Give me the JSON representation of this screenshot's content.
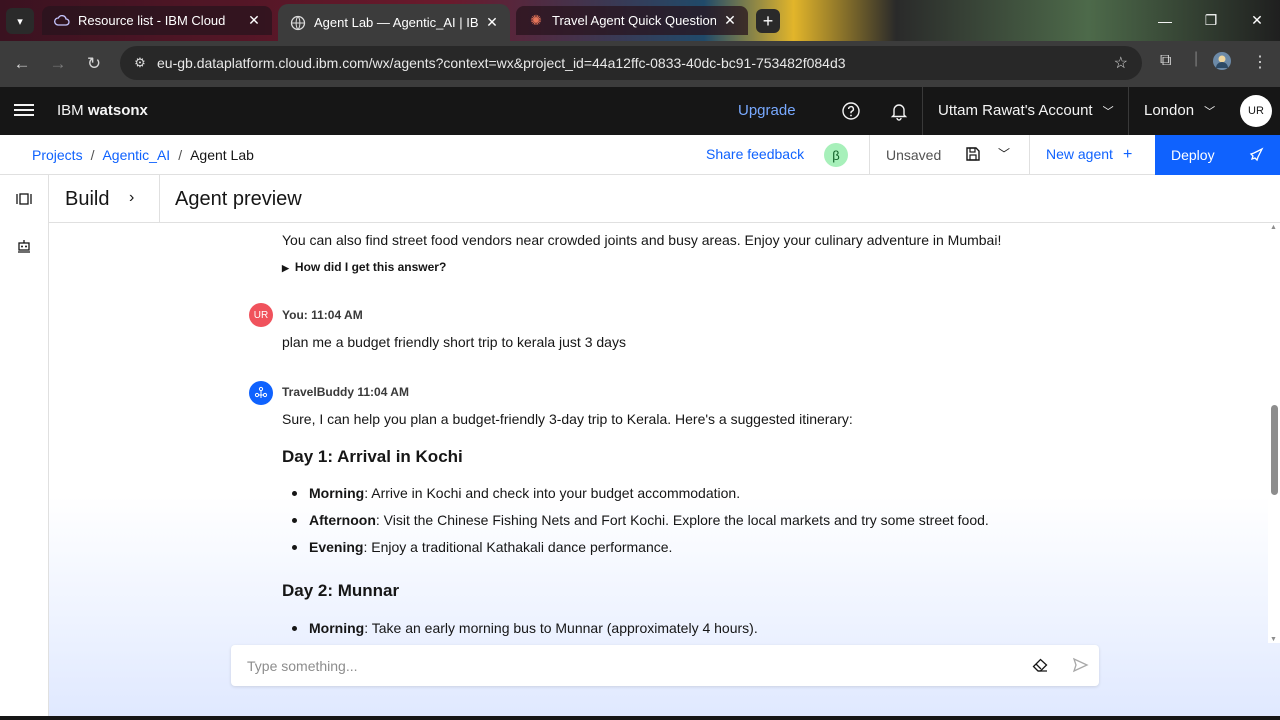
{
  "browser": {
    "tabs": [
      {
        "title": "Resource list - IBM Cloud",
        "active": false
      },
      {
        "title": "Agent Lab — Agentic_AI | IBM w",
        "active": true
      },
      {
        "title": "Travel Agent Quick Questions -",
        "active": false
      }
    ],
    "url": "eu-gb.dataplatform.cloud.ibm.com/wx/agents?context=wx&project_id=44a12ffc-0833-40dc-bc91-753482f084d3"
  },
  "header": {
    "brand_prefix": "IBM",
    "brand_name": "watsonx",
    "upgrade": "Upgrade",
    "account": "Uttam Rawat's Account",
    "region": "London",
    "avatar": "UR"
  },
  "toolbar": {
    "breadcrumbs": [
      "Projects",
      "Agentic_AI",
      "Agent Lab"
    ],
    "share_feedback": "Share feedback",
    "beta": "β",
    "status": "Unsaved",
    "new_agent": "New agent",
    "deploy": "Deploy"
  },
  "panel": {
    "build": "Build",
    "title": "Agent preview"
  },
  "chat": {
    "prev_text": "You can also find street food vendors near crowded joints and busy areas. Enjoy your culinary adventure in Mumbai!",
    "how": "How did I get this answer?",
    "user": {
      "avatar": "UR",
      "label": "You: 11:04 AM",
      "text": "plan me a budget friendly short trip to kerala just 3 days"
    },
    "bot": {
      "label": "TravelBuddy 11:04 AM",
      "intro": "Sure, I can help you plan a budget-friendly 3-day trip to Kerala. Here's a suggested itinerary:",
      "day1": {
        "heading": "Day 1: Arrival in Kochi",
        "items": [
          {
            "label": "Morning",
            "text": ": Arrive in Kochi and check into your budget accommodation."
          },
          {
            "label": "Afternoon",
            "text": ": Visit the Chinese Fishing Nets and Fort Kochi. Explore the local markets and try some street food."
          },
          {
            "label": "Evening",
            "text": ": Enjoy a traditional Kathakali dance performance."
          }
        ]
      },
      "day2": {
        "heading": "Day 2: Munnar",
        "items": [
          {
            "label": "Morning",
            "text": ": Take an early morning bus to Munnar (approximately 4 hours)."
          }
        ]
      }
    },
    "input_placeholder": "Type something..."
  }
}
